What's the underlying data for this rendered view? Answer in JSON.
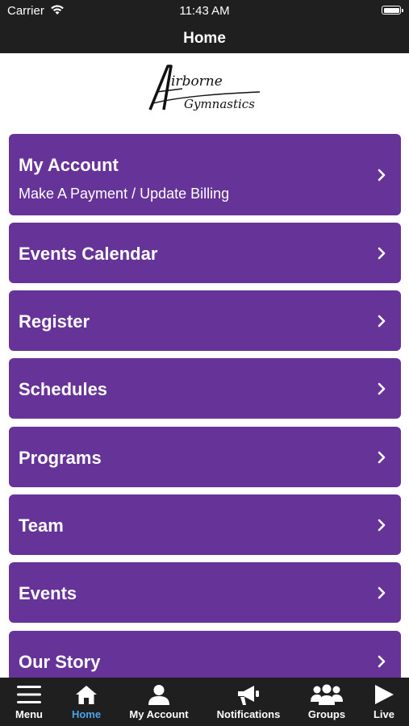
{
  "status_bar": {
    "carrier": "Carrier",
    "time": "11:43 AM"
  },
  "nav": {
    "title": "Home"
  },
  "logo": {
    "line1": "irborne",
    "line2": "Gymnastics",
    "letter": "A"
  },
  "menu": {
    "items": [
      {
        "label": "My Account",
        "subtitle": "Make A Payment / Update Billing"
      },
      {
        "label": "Events Calendar"
      },
      {
        "label": "Register"
      },
      {
        "label": "Schedules"
      },
      {
        "label": "Programs"
      },
      {
        "label": "Team"
      },
      {
        "label": "Events"
      },
      {
        "label": "Our Story"
      }
    ],
    "chevron_icon": "chevron-right-icon"
  },
  "tabs": [
    {
      "label": "Menu",
      "icon": "hamburger-icon"
    },
    {
      "label": "Home",
      "icon": "home-icon",
      "active": true
    },
    {
      "label": "My Account",
      "icon": "person-icon"
    },
    {
      "label": "Notifications",
      "icon": "megaphone-icon"
    },
    {
      "label": "Groups",
      "icon": "group-icon"
    },
    {
      "label": "Live",
      "icon": "play-icon"
    }
  ],
  "colors": {
    "tile_purple": "#663399",
    "bar_dark": "#1f1f1f",
    "active_tab_blue": "#4aa3ea"
  }
}
